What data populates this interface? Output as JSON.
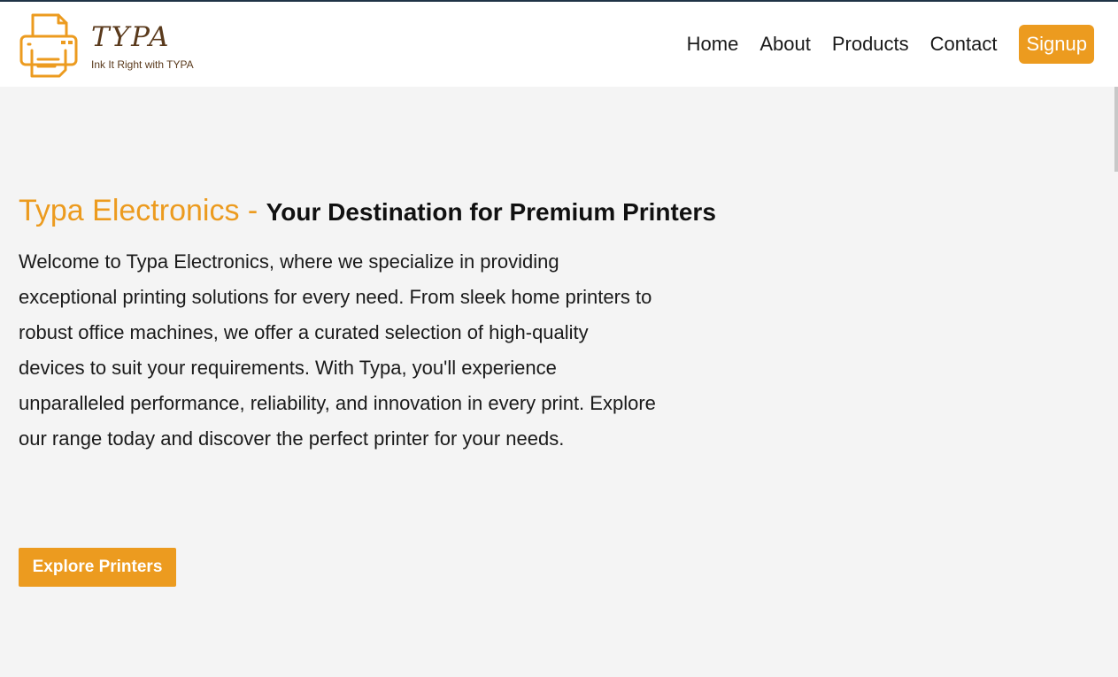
{
  "brand": {
    "name": "TYPA",
    "tagline": "Ink It Right with TYPA",
    "accent_color": "#ec9b1f",
    "logo_icon": "printer-icon"
  },
  "nav": {
    "links": [
      "Home",
      "About",
      "Products",
      "Contact"
    ],
    "signup_label": "Signup"
  },
  "hero": {
    "brand_part": "Typa Electronics - ",
    "headline": "Your Destination for Premium Printers",
    "description": "Welcome to Typa Electronics, where we specialize in providing exceptional printing solutions for every need. From sleek home printers to robust office machines, we offer a curated selection of high-quality devices to suit your requirements. With Typa, you'll experience unparalleled performance, reliability, and innovation in every print. Explore our range today and discover the perfect printer for your needs.",
    "cta_label": "Explore Printers"
  }
}
